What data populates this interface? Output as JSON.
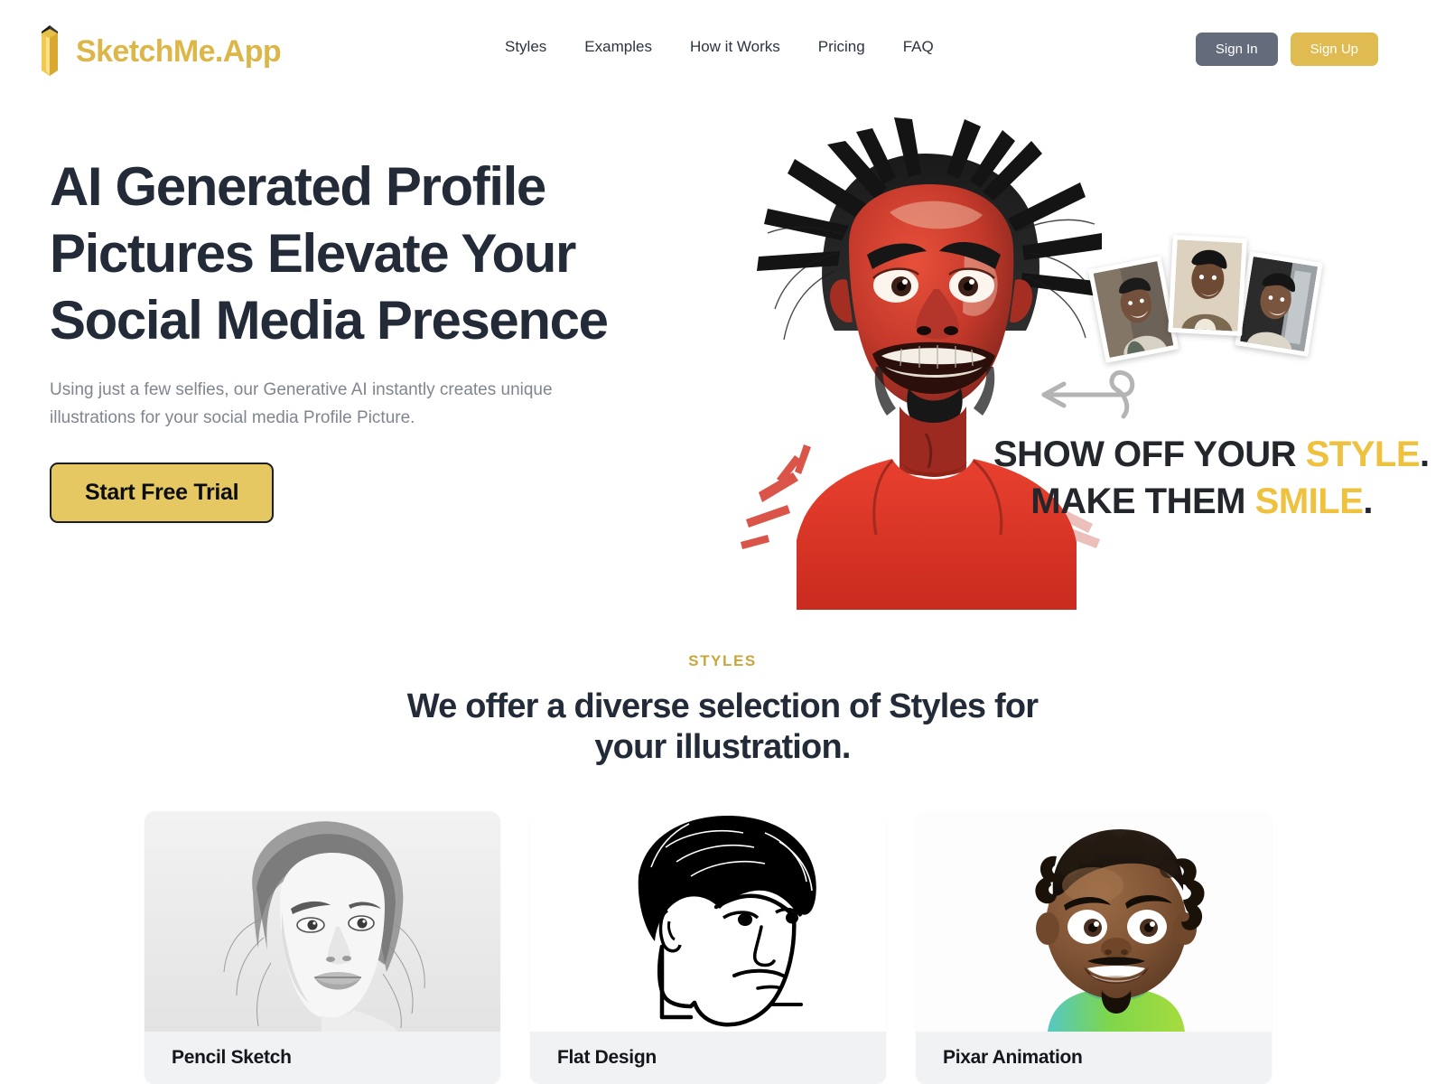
{
  "brand": {
    "name": "SketchMe.App",
    "logo_icon": "pencil-icon",
    "color": "#ddb64a"
  },
  "nav": {
    "items": [
      {
        "label": "Styles"
      },
      {
        "label": "Examples"
      },
      {
        "label": "How it Works"
      },
      {
        "label": "Pricing"
      },
      {
        "label": "FAQ"
      }
    ]
  },
  "auth": {
    "sign_in_label": "Sign In",
    "sign_up_label": "Sign Up",
    "sign_in_color": "#646c7c",
    "sign_up_color": "#e0bb52"
  },
  "hero": {
    "title": "AI Generated Profile Pictures Elevate Your Social Media Presence",
    "subtitle": "Using just a few selfies, our Generative AI instantly creates unique illustrations for your social media Profile Picture.",
    "cta_label": "Start Free Trial",
    "cta_color": "#e5c862",
    "art": {
      "alt": "caricature-illustration",
      "tagline_line1_main": "SHOW OFF YOUR",
      "tagline_line1_accent": "STYLE",
      "tagline_line2_main": "MAKE THEM",
      "tagline_line2_accent": "SMILE",
      "tagline_period": ".",
      "accent_color": "#eec13f",
      "arrow_icon": "curly-arrow-left-icon",
      "photos": [
        {
          "name": "selfie-photo-1"
        },
        {
          "name": "selfie-photo-2"
        },
        {
          "name": "selfie-photo-3"
        }
      ]
    }
  },
  "styles_section": {
    "eyebrow": "STYLES",
    "eyebrow_color": "#c9a63c",
    "title": "We offer a diverse selection of Styles for your illustration.",
    "cards": [
      {
        "label": "Pencil Sketch",
        "image_alt": "pencil-sketch-portrait"
      },
      {
        "label": "Flat Design",
        "image_alt": "flat-design-portrait"
      },
      {
        "label": "Pixar Animation",
        "image_alt": "pixar-animation-portrait"
      }
    ]
  }
}
